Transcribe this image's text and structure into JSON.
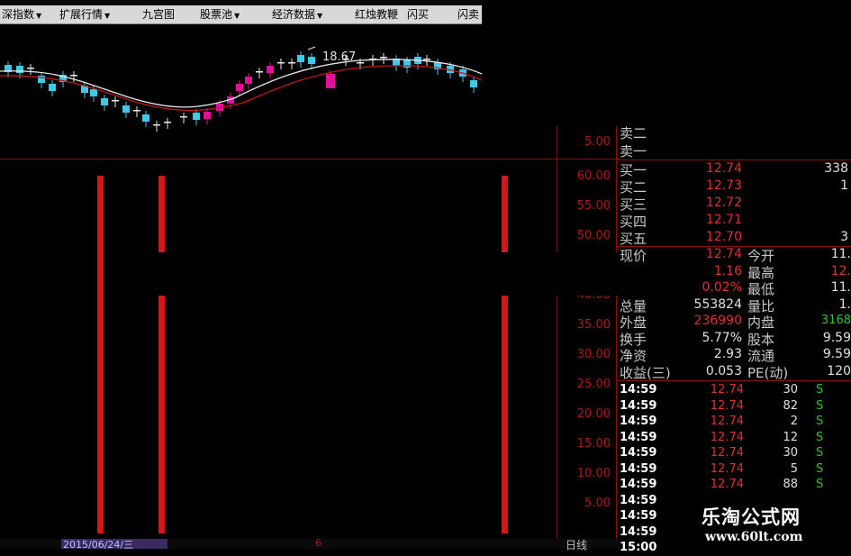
{
  "toolbar": {
    "items": [
      {
        "label": "深指数",
        "dropdown": true
      },
      {
        "label": "扩展行情",
        "dropdown": true
      },
      {
        "label": "九宫图",
        "dropdown": false
      },
      {
        "label": "股票池",
        "dropdown": true
      },
      {
        "label": "经济数据",
        "dropdown": true
      },
      {
        "label": "红烛教鞭",
        "dropdown": false
      },
      {
        "label": "闪买",
        "dropdown": false
      },
      {
        "label": "闪卖",
        "dropdown": false
      }
    ]
  },
  "chart": {
    "peak_label": "18.67",
    "upper_axis_label": "5.00",
    "indicator_axis": [
      "60.00",
      "55.00",
      "50.00",
      "40.00",
      "35.00",
      "30.00",
      "25.00",
      "20.00",
      "15.00",
      "10.00",
      "5.00"
    ],
    "date_label": "2015/06/24/三",
    "date_tick": "6",
    "period_label": "日线"
  },
  "quote": {
    "sell_rows": [
      {
        "label": "卖二"
      },
      {
        "label": "卖一"
      }
    ],
    "buy_rows": [
      {
        "label": "买一",
        "price": "12.74",
        "vol": "338"
      },
      {
        "label": "买二",
        "price": "12.73",
        "vol": "1"
      },
      {
        "label": "买三",
        "price": "12.72",
        "vol": ""
      },
      {
        "label": "买四",
        "price": "12.71",
        "vol": ""
      },
      {
        "label": "买五",
        "price": "12.70",
        "vol": "3"
      }
    ],
    "stats": [
      {
        "label": "现价",
        "value": "12.74",
        "label2": "今开",
        "value2": "11."
      },
      {
        "label": "",
        "value": "1.16",
        "label2": "最高",
        "value2": "12."
      },
      {
        "label": "",
        "value": "0.02%",
        "label2": "最低",
        "value2": "11."
      },
      {
        "label": "总量",
        "value": "553824",
        "label2": "量比",
        "value2": "1."
      },
      {
        "label": "外盘",
        "value": "236990",
        "label2": "内盘",
        "value2": "3168"
      },
      {
        "label": "换手",
        "value": "5.77%",
        "label2": "股本",
        "value2": "9.59"
      },
      {
        "label": "净资",
        "value": "2.93",
        "label2": "流通",
        "value2": "9.59"
      },
      {
        "label": "收益(三)",
        "value": "0.053",
        "label2": "PE(动)",
        "value2": "120"
      }
    ],
    "trades": [
      {
        "time": "14:59",
        "price": "12.74",
        "vol": "30",
        "side": "S"
      },
      {
        "time": "14:59",
        "price": "12.74",
        "vol": "82",
        "side": "S"
      },
      {
        "time": "14:59",
        "price": "12.74",
        "vol": "2",
        "side": "S"
      },
      {
        "time": "14:59",
        "price": "12.74",
        "vol": "12",
        "side": "S"
      },
      {
        "time": "14:59",
        "price": "12.74",
        "vol": "30",
        "side": "S"
      },
      {
        "time": "14:59",
        "price": "12.74",
        "vol": "5",
        "side": "S"
      },
      {
        "time": "14:59",
        "price": "12.74",
        "vol": "88",
        "side": "S"
      },
      {
        "time": "14:59",
        "price": "",
        "vol": "",
        "side": ""
      },
      {
        "time": "14:59",
        "price": "",
        "vol": "",
        "side": ""
      },
      {
        "time": "14:59",
        "price": "",
        "vol": "",
        "side": ""
      },
      {
        "time": "15:00",
        "price": "",
        "vol": "",
        "side": ""
      }
    ]
  },
  "watermark": {
    "title": "乐淘公式网",
    "url": "www.60lt.com"
  },
  "colors": {
    "bg": "#000000",
    "grid": "#8a1010",
    "up": "#e0109a",
    "down": "#40c8e8",
    "bar": "#d01818",
    "ma_white": "#e8e8e8",
    "ma_red": "#c01818"
  }
}
